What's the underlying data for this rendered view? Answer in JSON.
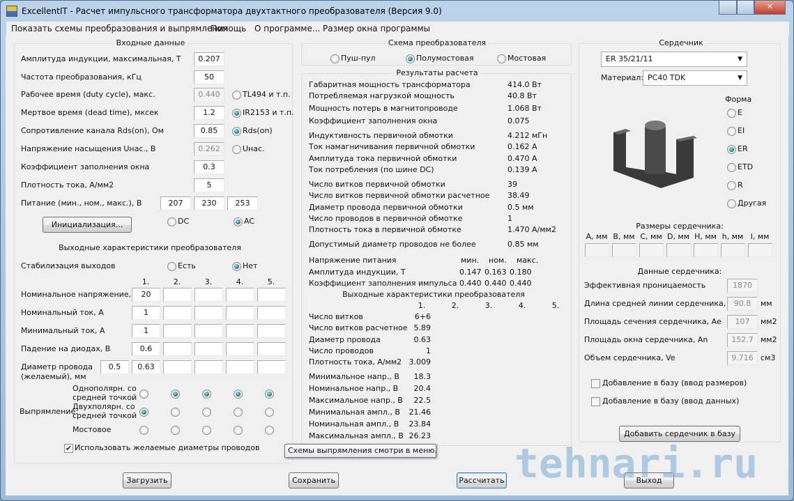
{
  "window": {
    "title": "ExcellentIT - Расчет импульсного трансформатора двухтактного преобразователя (Версия 9.0)"
  },
  "menu": [
    "Показать схемы преобразования и выпрямления",
    "Помощь",
    "О программе...",
    "Размер окна программы"
  ],
  "input": {
    "title": "Входные данные",
    "rows": [
      {
        "label": "Амплитуда индукции, максимальная, Т",
        "value": "0.207"
      },
      {
        "label": "Частота преобразования, кГц",
        "value": "50"
      },
      {
        "label": "Рабочее время (duty cycle), макс.",
        "value": "0.440",
        "disabled": true
      },
      {
        "label": "Мертвое время (dead time), мксек",
        "value": "1.2"
      },
      {
        "label": "Сопротивление канала Rds(on), Ом",
        "value": "0.85"
      },
      {
        "label": "Напряжение насыщения Uнас., В",
        "value": "0.262",
        "disabled": true
      },
      {
        "label": "Коэффициент заполнения окна",
        "value": "0.3"
      },
      {
        "label": "Плотность тока, А/мм2",
        "value": "5"
      }
    ],
    "controller_options": [
      {
        "label": "TL494 и т.п.",
        "checked": false
      },
      {
        "label": "IR2153 и т.п.",
        "checked": true
      }
    ],
    "switch_options": [
      {
        "label": "Rds(on)",
        "checked": true
      },
      {
        "label": "Uнас.",
        "checked": false
      }
    ],
    "supply_label": "Питание (мин., ном., макс.), В",
    "supply": [
      "207",
      "230",
      "253"
    ],
    "init_button": "Инициализация...",
    "dc_label": "DC",
    "ac_label": "AC",
    "ac_checked": true
  },
  "output": {
    "title": "Выходные характеристики преобразователя",
    "stab_label": "Стабилизация выходов",
    "stab_yes": "Есть",
    "stab_no": "Нет",
    "stab": "no",
    "columns": [
      "1.",
      "2.",
      "3.",
      "4.",
      "5."
    ],
    "rows": [
      {
        "label": "Номинальное напряжение, В",
        "values": [
          "20",
          "",
          "",
          "",
          ""
        ]
      },
      {
        "label": "Номинальный ток, А",
        "values": [
          "1",
          "",
          "",
          "",
          ""
        ]
      },
      {
        "label": "Минимальный ток, А",
        "values": [
          "1",
          "",
          "",
          "",
          ""
        ]
      },
      {
        "label": "Падение на диодах, В",
        "values": [
          "0.6",
          "",
          "",
          "",
          ""
        ]
      }
    ],
    "diam_label1": "Диаметр провода",
    "diam_label2": "(желаемый), мм",
    "diam_extra": "0.5",
    "diam_values": [
      "0.63",
      "",
      "",
      "",
      ""
    ],
    "rect_label": "Выпрямление:",
    "rect_rows": [
      {
        "l1": "Однополярн. со",
        "l2": "средней точкой",
        "checked": [
          false,
          true,
          true,
          true,
          true
        ]
      },
      {
        "l1": "Двухполярн. со",
        "l2": "средней точкой",
        "checked": [
          true,
          false,
          false,
          false,
          false
        ]
      },
      {
        "l1": "Мостовое",
        "l2": "",
        "checked": [
          false,
          false,
          false,
          false,
          false
        ]
      }
    ],
    "use_diam_label": "Использовать желаемые диаметры проводов",
    "use_diam_checked": true
  },
  "scheme": {
    "title": "Схема преобразователя",
    "options": [
      {
        "label": "Пуш-пул",
        "checked": false
      },
      {
        "label": "Полумостовая",
        "checked": true
      },
      {
        "label": "Мостовая",
        "checked": false
      }
    ]
  },
  "results": {
    "title": "Результаты расчета",
    "rows": [
      {
        "label": "Габаритная мощность трансформатора",
        "value": "414.0 Вт"
      },
      {
        "label": "Потребляемая нагрузкой мощность",
        "value": "40.8 Вт"
      },
      {
        "label": "Мощность потерь в магнитопроводе",
        "value": "1.068 Вт"
      },
      {
        "label": "Коэффициент заполнения окна",
        "value": "0.075"
      },
      {
        "label": "Индуктивность первичной обмотки",
        "value": "4.212 мГн"
      },
      {
        "label": "Ток намагничивания первичной обмотки",
        "value": "0.162 А"
      },
      {
        "label": "Амплитуда тока первичной обмотки",
        "value": "0.470 А"
      },
      {
        "label": "Ток потребления (по шине DC)",
        "value": "0.139 А"
      },
      {
        "label": "Число витков первичной обмотки",
        "value": "39"
      },
      {
        "label": "Число витков первичной обмотки расчетное",
        "value": "38.49"
      },
      {
        "label": "Диаметр провода первичной обмотки",
        "value": "0.5 мм"
      },
      {
        "label": "Число проводов в первичной обмотке",
        "value": "1"
      },
      {
        "label": "Плотность тока в первичной обмотке",
        "value": "1.470 А/мм2"
      },
      {
        "label": "Допустимый диаметр проводов не более",
        "value": "0.85 мм"
      }
    ],
    "supply_label": "Напряжение питания",
    "supply_cols": [
      "мин.",
      "ном.",
      "макс."
    ],
    "supply_rows": [
      {
        "label": "Амплитуда индукции, Т",
        "values": [
          "0.147",
          "0.163",
          "0.180"
        ]
      },
      {
        "label": "Коэффициент заполнения импульса",
        "values": [
          "0.440",
          "0.440",
          "0.440"
        ]
      }
    ],
    "out_title": "Выходные характеристики преобразователя",
    "out_cols": [
      "1.",
      "2.",
      "3.",
      "4.",
      "5."
    ],
    "out_rows": [
      {
        "label": "Число витков",
        "value": "6+6"
      },
      {
        "label": "Число витков расчетное",
        "value": "5.89"
      },
      {
        "label": "Диаметр провода",
        "value": "0.63"
      },
      {
        "label": "Число проводов",
        "value": "1"
      },
      {
        "label": "Плотность тока, А/мм2",
        "value": "3.009"
      },
      {
        "label": "Минимальное напр., В",
        "value": "18.3"
      },
      {
        "label": "Номинальное напр., В",
        "value": "20.4"
      },
      {
        "label": "Максимальное напр., В",
        "value": "22.5"
      },
      {
        "label": "Минимальная ампл., В",
        "value": "21.46"
      },
      {
        "label": "Номинальная ампл., В",
        "value": "23.84"
      },
      {
        "label": "Максимальная ампл., В",
        "value": "26.23"
      }
    ]
  },
  "core": {
    "title": "Сердечник",
    "model": "ER 35/21/11",
    "material_label": "Материал:",
    "material": "PC40 TDK",
    "shape_label": "Форма",
    "shapes": [
      {
        "label": "E",
        "checked": false
      },
      {
        "label": "EI",
        "checked": false
      },
      {
        "label": "ER",
        "checked": true
      },
      {
        "label": "ETD",
        "checked": false
      },
      {
        "label": "R",
        "checked": false
      },
      {
        "label": "Другая",
        "checked": false
      }
    ],
    "sizes_title": "Размеры сердечника:",
    "size_cols": [
      "A, мм",
      "B, мм",
      "C, мм",
      "D, мм",
      "H, мм",
      "h, мм",
      "I, мм"
    ],
    "data_title": "Данные сердечника:",
    "data_rows": [
      {
        "label": "Эффективная проницаемость",
        "value": "1870",
        "unit": ""
      },
      {
        "label": "Длина средней линии сердечника, le",
        "value": "90.8",
        "unit": "мм"
      },
      {
        "label": "Площадь сечения сердечника, Ae",
        "value": "107",
        "unit": "мм2"
      },
      {
        "label": "Площадь окна сердечника, An",
        "value": "152.7",
        "unit": "мм2"
      },
      {
        "label": "Объем сердечника, Ve",
        "value": "9.716",
        "unit": "см3"
      }
    ],
    "add_sizes": "Добавление в базу (ввод размеров)",
    "add_data": "Добавление в базу (ввод данных)",
    "add_button": "Добавить сердечник в базу"
  },
  "buttons": {
    "load": "Загрузить",
    "save": "Сохранить",
    "calc": "Рассчитать",
    "exit": "Выход"
  },
  "tooltip": "Схемы выпрямления смотри в меню.",
  "watermark": "tehnari.ru"
}
